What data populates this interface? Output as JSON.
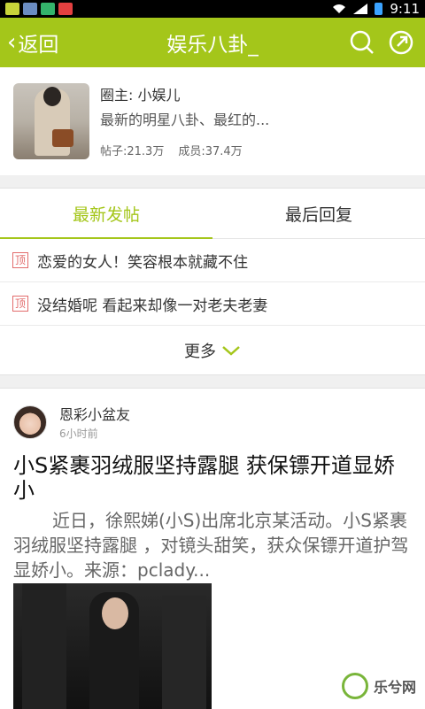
{
  "statusbar": {
    "time": "9:11"
  },
  "header": {
    "back_label": "返回",
    "title": "娱乐八卦_",
    "search_icon": "search-icon",
    "share_icon": "share-icon"
  },
  "info": {
    "owner": "圈主: 小娱儿",
    "desc": "最新的明星八卦、最红的...",
    "posts": "帖子:21.3万",
    "members": "成员:37.4万"
  },
  "tabs": [
    {
      "label": "最新发帖",
      "active": true
    },
    {
      "label": "最后回复",
      "active": false
    }
  ],
  "pinned": [
    {
      "badge": "顶",
      "text": "恋爱的女人！笑容根本就藏不住"
    },
    {
      "badge": "顶",
      "text": "没结婚呢 看起来却像一对老夫老妻"
    }
  ],
  "more_label": "更多",
  "post": {
    "author": "恩彩小盆友",
    "time": "6小时前",
    "title": "小S紧裹羽绒服坚持露腿 获保镖开道显娇小",
    "body": "近日，徐熙娣(小S)出席北京某活动。小S紧裹羽绒服坚持露腿 ，对镜头甜笑，获众保镖开道护驾显娇小。来源：pclady..."
  },
  "watermark": {
    "text": "乐兮网"
  },
  "colors": {
    "accent": "#a4c61a",
    "pin": "#e26c6c"
  }
}
